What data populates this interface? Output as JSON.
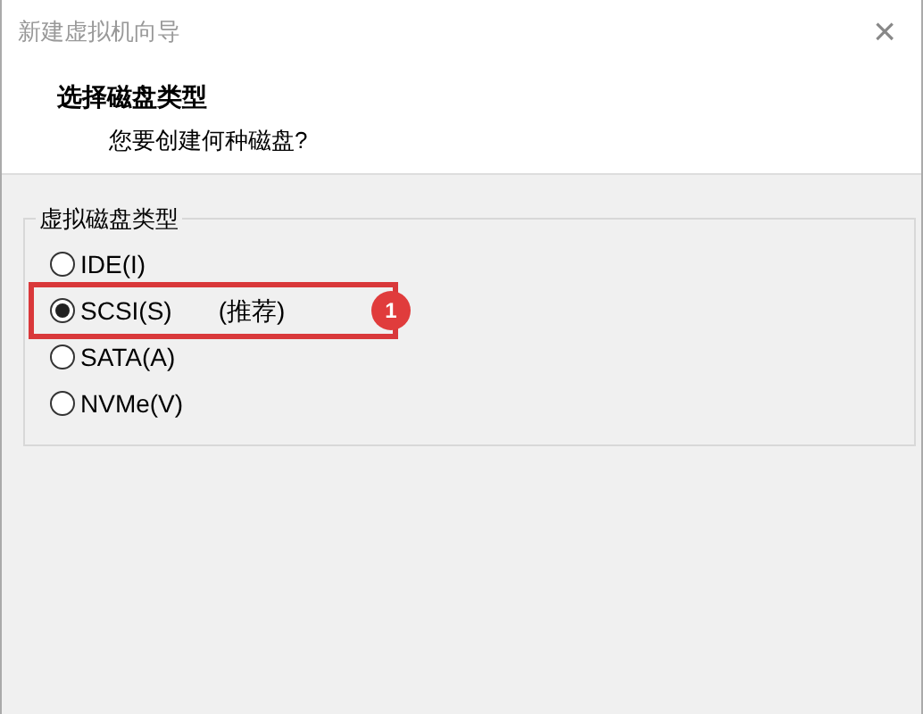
{
  "window": {
    "title": "新建虚拟机向导",
    "close": "×"
  },
  "header": {
    "title": "选择磁盘类型",
    "subtitle": "您要创建何种磁盘?"
  },
  "group": {
    "legend": "虚拟磁盘类型",
    "options": [
      {
        "label": "IDE(I)",
        "selected": false,
        "highlighted": false
      },
      {
        "label": "SCSI(S)",
        "note": "(推荐)",
        "selected": true,
        "highlighted": true,
        "badge": "1"
      },
      {
        "label": "SATA(A)",
        "selected": false,
        "highlighted": false
      },
      {
        "label": "NVMe(V)",
        "selected": false,
        "highlighted": false
      }
    ]
  }
}
